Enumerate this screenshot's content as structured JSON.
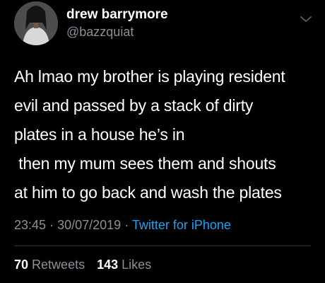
{
  "tweet": {
    "author": {
      "display_name": "drew barrymore",
      "handle": "@bazzquiat"
    },
    "text": "Ah lmao my brother is playing resident\nevil and passed by a stack of dirty\nplates in a house he’s in\n then my mum sees them and shouts\nat him to go back and wash the plates",
    "time": "23:45",
    "separator": "·",
    "date": "30/07/2019",
    "source": "Twitter for iPhone",
    "stats": {
      "retweets_count": "70",
      "retweets_label": "Retweets",
      "likes_count": "143",
      "likes_label": "Likes"
    }
  },
  "colors": {
    "background": "#000000",
    "text": "#ffffff",
    "secondary": "#8a9197",
    "link": "#1da1f2",
    "divider": "#2f3336"
  },
  "icons": {
    "more": "chevron-down-icon"
  }
}
